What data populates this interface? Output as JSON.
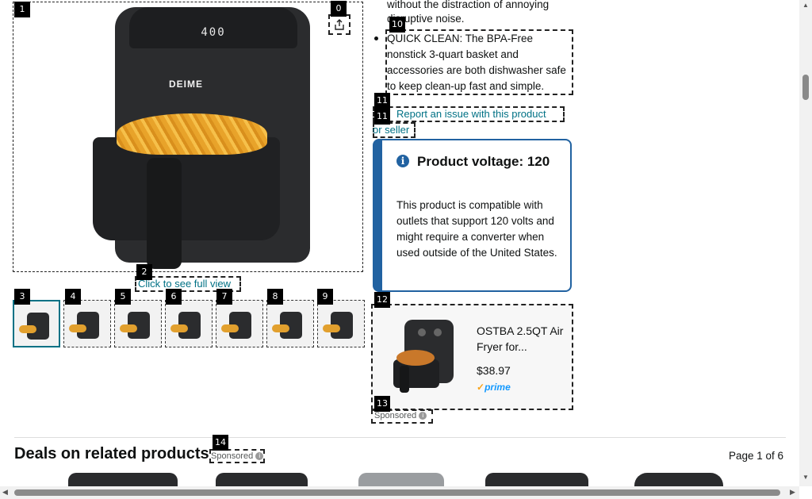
{
  "markers": [
    "0",
    "1",
    "2",
    "3",
    "4",
    "5",
    "6",
    "7",
    "8",
    "9",
    "10",
    "11",
    "11",
    "12",
    "13",
    "14"
  ],
  "main_image": {
    "display_text": "400",
    "brand": "DEIME",
    "click_full_view": "Click to see full view"
  },
  "thumbnails": [
    {
      "label": "thumbnail-1",
      "selected": true
    },
    {
      "label": "thumbnail-2"
    },
    {
      "label": "thumbnail-3"
    },
    {
      "label": "thumbnail-4"
    },
    {
      "label": "thumbnail-5"
    },
    {
      "label": "thumbnail-6"
    },
    {
      "label": "thumbnail-7"
    }
  ],
  "bullets": {
    "partial_1": "without the distraction of annoying",
    "partial_2": "disruptive noise.",
    "quick_clean": "QUICK CLEAN: The BPA-Free nonstick 3-quart basket and accessories are both dishwasher safe to keep clean-up fast and simple."
  },
  "report": {
    "line1": "Report an issue with this product",
    "line2": "or seller"
  },
  "voltage": {
    "info_icon": "i",
    "title": "Product voltage: 120",
    "body": "This product is compatible with outlets that support 120 volts and might require a converter when used outside of the United States."
  },
  "ad": {
    "title": "OSTBA 2.5QT Air Fryer for...",
    "price": "$38.97",
    "prime": "prime",
    "sponsored": "Sponsored"
  },
  "deals": {
    "title": "Deals on related products",
    "sponsored": "Sponsored",
    "page": "Page 1 of 6"
  },
  "scroll": {
    "up": "▲",
    "down": "▼",
    "left": "◀",
    "right": "▶"
  },
  "colors": {
    "link": "#007185",
    "info_blue": "#2162a1",
    "prime_blue": "#1399ff"
  }
}
